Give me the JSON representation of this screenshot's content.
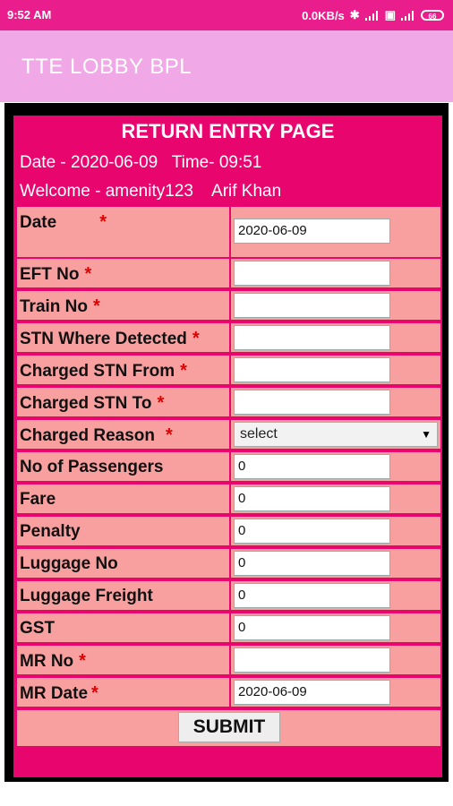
{
  "status": {
    "time": "9:52 AM",
    "net_speed": "0.0KB/s",
    "battery": "66"
  },
  "app": {
    "title": "TTE LOBBY BPL"
  },
  "page": {
    "heading": "RETURN ENTRY PAGE",
    "date_text": "Date - 2020-06-09   Time- 09:51",
    "welcome_text": "Welcome - amenity123    Arif Khan"
  },
  "form": {
    "date_label": "Date",
    "date_value": "2020-06-09",
    "eft_label": "EFT No",
    "eft_value": "",
    "train_label": "Train No",
    "train_value": "",
    "stn_detected_label": "STN Where Detected",
    "stn_detected_value": "",
    "charged_from_label": "Charged STN From",
    "charged_from_value": "",
    "charged_to_label": "Charged STN To",
    "charged_to_value": "",
    "reason_label": "Charged Reason",
    "reason_value": "select",
    "passengers_label": "No of Passengers",
    "passengers_value": "0",
    "fare_label": "Fare",
    "fare_value": "0",
    "penalty_label": "Penalty",
    "penalty_value": "0",
    "luggage_no_label": "Luggage No",
    "luggage_no_value": "0",
    "luggage_freight_label": "Luggage Freight",
    "luggage_freight_value": "0",
    "gst_label": "GST",
    "gst_value": "0",
    "mr_no_label": "MR No",
    "mr_no_value": "",
    "mr_date_label": "MR Date",
    "mr_date_value": "2020-06-09",
    "required_mark": "*",
    "submit_label": "SUBMIT"
  },
  "colors": {
    "status": "#e91e8c",
    "appbar": "#f0a8e6",
    "page": "#e8066e",
    "cell": "#f8a0a0",
    "required": "#e00000"
  },
  "icons": [
    "bluetooth-icon",
    "signal-icon",
    "wifi-icon",
    "signal-4g-icon",
    "battery-icon"
  ]
}
